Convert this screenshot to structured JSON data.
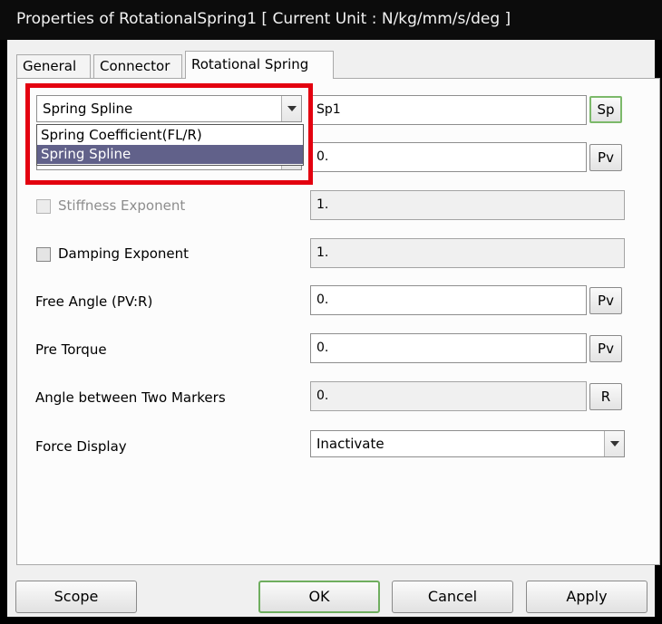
{
  "window": {
    "title": "Properties of RotationalSpring1 [ Current Unit : N/kg/mm/s/deg ]"
  },
  "tabs": [
    {
      "label": "General"
    },
    {
      "label": "Connector"
    },
    {
      "label": "Rotational Spring"
    }
  ],
  "spring_type": {
    "selected": "Spring Spline",
    "options": [
      "Spring Coefficient(FL/R)",
      "Spring Spline"
    ],
    "value": "Sp1",
    "button": "Sp"
  },
  "damping": {
    "value": "0.",
    "button": "Pv"
  },
  "stiffness_exponent": {
    "label": "Stiffness Exponent",
    "value": "1."
  },
  "damping_exponent": {
    "label": "Damping Exponent",
    "value": "1."
  },
  "free_angle": {
    "label": "Free Angle (PV:R)",
    "value": "0.",
    "button": "Pv"
  },
  "pre_torque": {
    "label": "Pre Torque",
    "value": "0.",
    "button": "Pv"
  },
  "angle_between": {
    "label": "Angle between Two Markers",
    "value": "0.",
    "button": "R"
  },
  "force_display": {
    "label": "Force Display",
    "selected": "Inactivate"
  },
  "buttons": {
    "scope": "Scope",
    "ok": "OK",
    "cancel": "Cancel",
    "apply": "Apply"
  },
  "colors": {
    "highlight_box": "#e3000f",
    "selection": "#61618a",
    "default_button_border": "#6fae5f"
  }
}
